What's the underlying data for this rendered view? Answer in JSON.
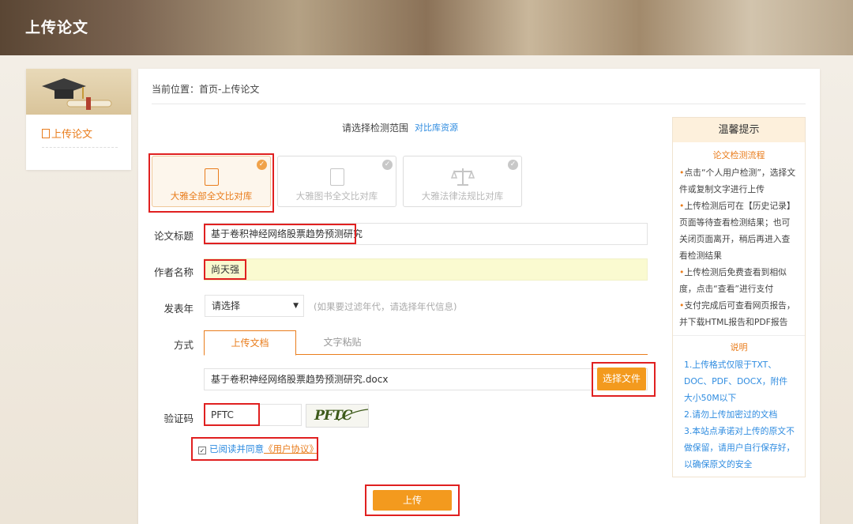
{
  "page": {
    "title": "上传论文"
  },
  "sidebar": {
    "item_label": "上传论文"
  },
  "breadcrumb": "当前位置：首页-上传论文",
  "scope": {
    "label": "请选择检测范围",
    "link": "对比库资源",
    "cards": [
      {
        "label": "大雅全部全文比对库",
        "active": true
      },
      {
        "label": "大雅图书全文比对库",
        "active": false
      },
      {
        "label": "大雅法律法规比对库",
        "active": false
      }
    ]
  },
  "form": {
    "title_label": "论文标题",
    "title_value": "基于卷积神经网络股票趋势预测研究",
    "author_label": "作者名称",
    "author_value": "尚天强",
    "year_label": "发表年",
    "year_select": "请选择",
    "year_hint": "(如果要过滤年代，请选择年代信息)",
    "method_label": "方式",
    "tabs": [
      "上传文档",
      "文字粘贴"
    ],
    "file_name": "基于卷积神经网络股票趋势预测研究.docx",
    "choose_file": "选择文件",
    "captcha_label": "验证码",
    "captcha_value": "PFTC",
    "captcha_image_text": "PFTC",
    "agree_prefix": "已阅读并同意",
    "agree_link": "《用户协议》",
    "upload_button": "上传"
  },
  "tips": {
    "header": "温馨提示",
    "flow_title": "论文检测流程",
    "flow_items": [
      "点击“个人用户检测”，选择文件或复制文字进行上传",
      "上传检测后可在【历史记录】页面等待查看检测结果；也可关闭页面离开，稍后再进入查看检测结果",
      "上传检测后免费查看到相似度，点击“查看”进行支付",
      "支付完成后可查看网页报告，并下载HTML报告和PDF报告"
    ],
    "notes_title": "说明",
    "notes": [
      "1.上传格式仅限于TXT、DOC、PDF、DOCX，附件大小50M以下",
      "2.请勿上传加密过的文档",
      "3.本站点承诺对上传的原文不做保留，请用户自行保存好，以确保原文的安全"
    ]
  },
  "colors": {
    "accent": "#e97d1d",
    "button": "#f39a1e",
    "link": "#2f8ce0",
    "highlight_box": "#e02020"
  }
}
